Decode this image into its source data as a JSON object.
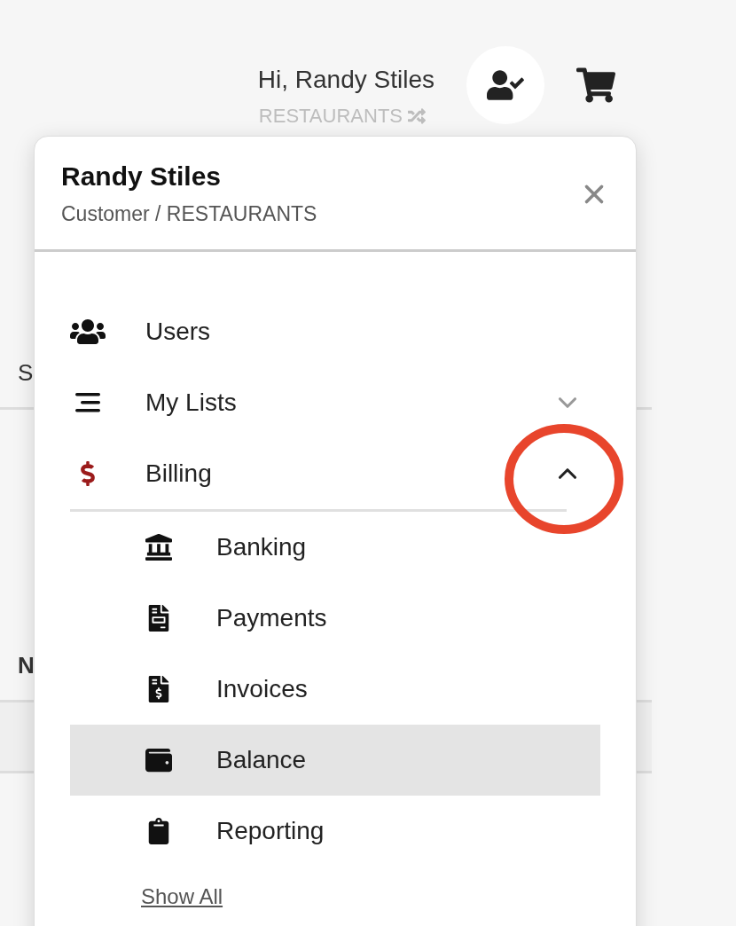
{
  "header": {
    "greeting": "Hi, Randy Stiles",
    "account": "RESTAURANTS"
  },
  "background_fragments": [
    "S",
    "N"
  ],
  "menu": {
    "name": "Randy Stiles",
    "subtitle": "Customer / RESTAURANTS",
    "items": [
      {
        "kind": "link",
        "label": "Users"
      },
      {
        "kind": "group",
        "label": "My Lists",
        "expanded": false
      },
      {
        "kind": "group",
        "label": "Billing",
        "expanded": true,
        "children": [
          {
            "label": "Banking",
            "selected": false
          },
          {
            "label": "Payments",
            "selected": false
          },
          {
            "label": "Invoices",
            "selected": false
          },
          {
            "label": "Balance",
            "selected": true
          },
          {
            "label": "Reporting",
            "selected": false
          }
        ]
      }
    ],
    "show_all": "Show All"
  }
}
